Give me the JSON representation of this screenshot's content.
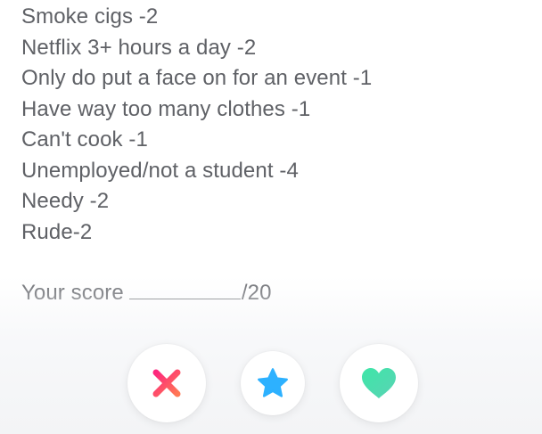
{
  "profile": {
    "lines": [
      "Smoke cigs -2",
      "Netflix 3+ hours a day -2",
      "Only do put a face on for an event -1",
      "Have way too many clothes -1",
      "Can't cook -1",
      "Unemployed/not a student -4",
      "Needy -2",
      "Rude-2"
    ],
    "score_prefix": "Your score",
    "score_suffix": "/20"
  },
  "actions": {
    "nope_icon": "x-icon",
    "superlike_icon": "star-icon",
    "like_icon": "heart-icon"
  },
  "colors": {
    "text": "#5f6166",
    "nope_start": "#fd267d",
    "nope_end": "#ff7854",
    "star": "#2db1ff",
    "heart_start": "#3ee6a8",
    "heart_end": "#5ad3b4"
  }
}
